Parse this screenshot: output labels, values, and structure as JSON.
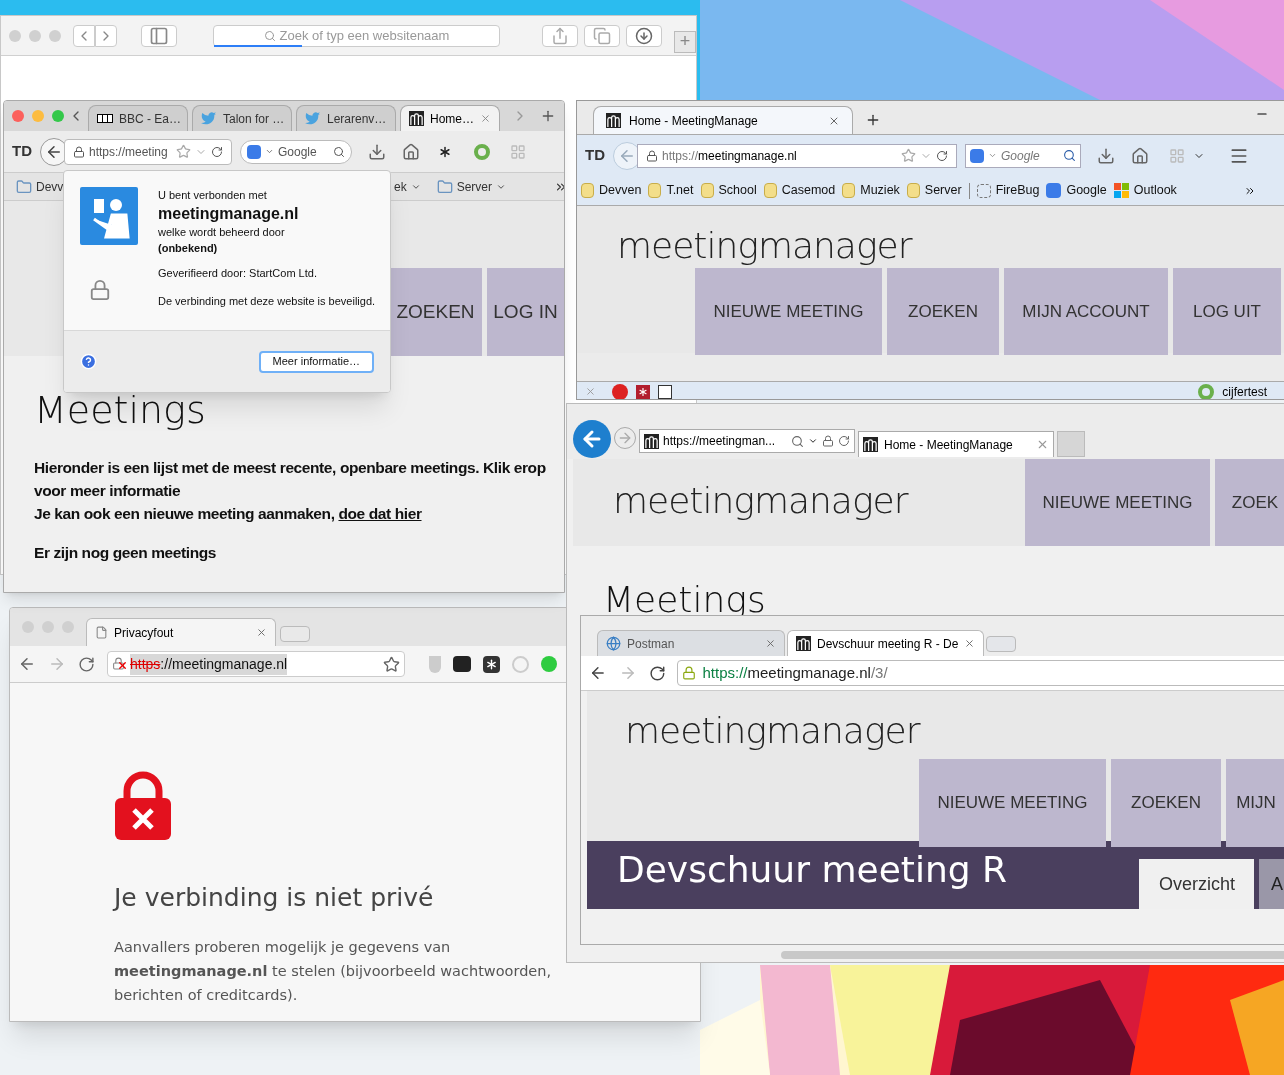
{
  "safari": {
    "search_placeholder": "Zoek of typ een websitenaam",
    "new_tab": "+"
  },
  "firefox_mac": {
    "tabs": [
      {
        "title": "BBC - Ea…",
        "kind": "bbc",
        "selected": false
      },
      {
        "title": "Talon for …",
        "kind": "bird",
        "selected": false
      },
      {
        "title": "Lerarenv…",
        "kind": "bird",
        "selected": false
      },
      {
        "title": "Home…",
        "kind": "meeting",
        "selected": true
      }
    ],
    "logo": "TD",
    "url": "https://meeting",
    "search": "Google",
    "bookmarks_left": [
      "Devv"
    ],
    "bookmarks_right": [
      {
        "label": "ek",
        "kind": "plain"
      },
      {
        "label": "Server",
        "kind": "folder"
      }
    ],
    "nav": [
      "ZOEKEN",
      "LOG IN"
    ],
    "heading": "Meetings",
    "intro": "Hieronder is een lijst met de meest recente, openbare meetings. Klik erop voor meer informatie",
    "create_text": "Je kan ook een nieuwe meeting aanmaken,",
    "create_link": "doe dat hier",
    "empty": "Er zijn nog geen meetings"
  },
  "identity_popup": {
    "connected": "U bent verbonden met",
    "domain": "meetingmanage.nl",
    "managed": "welke wordt beheerd door",
    "owner": "(onbekend)",
    "verified": "Geverifieerd door: StartCom Ltd.",
    "secure": "De verbinding met deze website is beveiligd.",
    "button": "Meer informatie…"
  },
  "firefox_win": {
    "tab": "Home - MeetingManage",
    "logo": "TD",
    "url_scheme": "https://",
    "url_host": "meetingmanage.nl",
    "search": "Google",
    "bookmarks": [
      {
        "label": "Devven",
        "kind": "folder"
      },
      {
        "label": "T.net",
        "kind": "folder"
      },
      {
        "label": "School",
        "kind": "folder"
      },
      {
        "label": "Casemod",
        "kind": "folder"
      },
      {
        "label": "Muziek",
        "kind": "folder"
      },
      {
        "label": "Server",
        "kind": "folder"
      },
      {
        "label": "FireBug",
        "kind": "dashed"
      },
      {
        "label": "Google",
        "kind": "google"
      },
      {
        "label": "Outlook",
        "kind": "windows"
      }
    ],
    "site_logo": "meetingmanager",
    "nav": [
      "NIEUWE MEETING",
      "ZOEKEN",
      "MIJN ACCOUNT",
      "LOG UIT"
    ],
    "status_item": "cijfertest"
  },
  "ie": {
    "url": "https://meetingman...",
    "tab": "Home - MeetingManage",
    "site_logo": "meetingmanager",
    "nav": [
      "NIEUWE MEETING",
      "ZOEK"
    ],
    "heading": "Meetings"
  },
  "chrome_mac": {
    "tab": "Privacyfout",
    "url_scheme": "https",
    "url_rest": "://meetingmanage.nl",
    "heading": "Je verbinding is niet privé",
    "body": "Aanvallers proberen mogelijk je gegevens van **meetingmanage.nl** te stelen (bijvoorbeeld wachtwoorden, berichten of creditcards)."
  },
  "chrome_win": {
    "tabs": [
      {
        "title": "Postman",
        "kind": "globe",
        "selected": false
      },
      {
        "title": "Devschuur meeting R - De",
        "kind": "meeting",
        "selected": true
      }
    ],
    "url_scheme": "https://",
    "url_host": "meetingmanage.nl",
    "url_path": "/3/",
    "site_logo": "meetingmanager",
    "nav": [
      "NIEUWE MEETING",
      "ZOEKEN",
      "MIJN"
    ],
    "title": "Devschuur meeting R",
    "page_tabs": [
      {
        "label": "Overzicht",
        "selected": true
      },
      {
        "label": "A",
        "selected": false
      }
    ]
  }
}
